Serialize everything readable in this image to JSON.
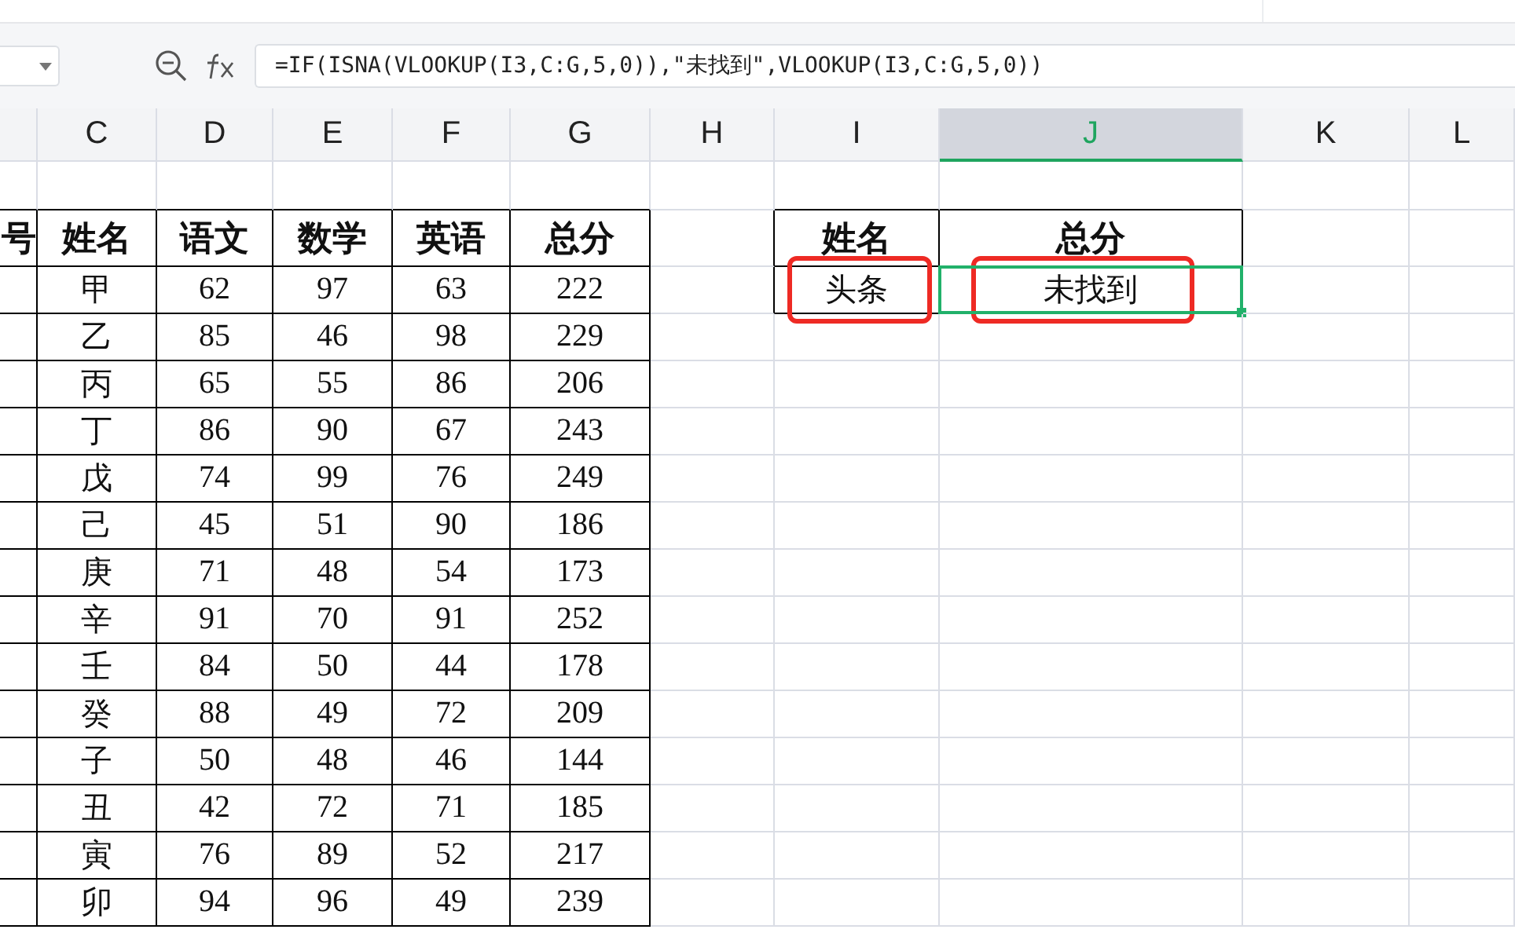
{
  "formula_bar": {
    "formula": "=IF(ISNA(VLOOKUP(I3,C:G,5,0)),\"未找到\",VLOOKUP(I3,C:G,5,0))"
  },
  "columns": [
    {
      "label": "C",
      "selected": false
    },
    {
      "label": "D",
      "selected": false
    },
    {
      "label": "E",
      "selected": false
    },
    {
      "label": "F",
      "selected": false
    },
    {
      "label": "G",
      "selected": false
    },
    {
      "label": "H",
      "selected": false
    },
    {
      "label": "I",
      "selected": false
    },
    {
      "label": "J",
      "selected": true
    },
    {
      "label": "K",
      "selected": false
    },
    {
      "label": "L",
      "selected": false
    }
  ],
  "score_table": {
    "id_header_fragment": "号",
    "header": [
      "姓名",
      "语文",
      "数学",
      "英语",
      "总分"
    ],
    "rows": [
      {
        "name": "甲",
        "scores": [
          "62",
          "97",
          "63",
          "222"
        ]
      },
      {
        "name": "乙",
        "scores": [
          "85",
          "46",
          "98",
          "229"
        ]
      },
      {
        "name": "丙",
        "scores": [
          "65",
          "55",
          "86",
          "206"
        ]
      },
      {
        "name": "丁",
        "scores": [
          "86",
          "90",
          "67",
          "243"
        ]
      },
      {
        "name": "戊",
        "scores": [
          "74",
          "99",
          "76",
          "249"
        ]
      },
      {
        "name": "己",
        "scores": [
          "45",
          "51",
          "90",
          "186"
        ]
      },
      {
        "name": "庚",
        "scores": [
          "71",
          "48",
          "54",
          "173"
        ]
      },
      {
        "name": "辛",
        "scores": [
          "91",
          "70",
          "91",
          "252"
        ]
      },
      {
        "name": "壬",
        "scores": [
          "84",
          "50",
          "44",
          "178"
        ]
      },
      {
        "name": "癸",
        "scores": [
          "88",
          "49",
          "72",
          "209"
        ]
      },
      {
        "name": "子",
        "scores": [
          "50",
          "48",
          "46",
          "144"
        ]
      },
      {
        "name": "丑",
        "scores": [
          "42",
          "72",
          "71",
          "185"
        ]
      },
      {
        "name": "寅",
        "scores": [
          "76",
          "89",
          "52",
          "217"
        ]
      },
      {
        "name": "卯",
        "scores": [
          "94",
          "96",
          "49",
          "239"
        ]
      }
    ]
  },
  "lookup": {
    "header": [
      "姓名",
      "总分"
    ],
    "values": [
      {
        "text": "头条",
        "highlighted": true,
        "selected": false
      },
      {
        "text": "未找到",
        "highlighted": true,
        "selected": true
      }
    ]
  }
}
